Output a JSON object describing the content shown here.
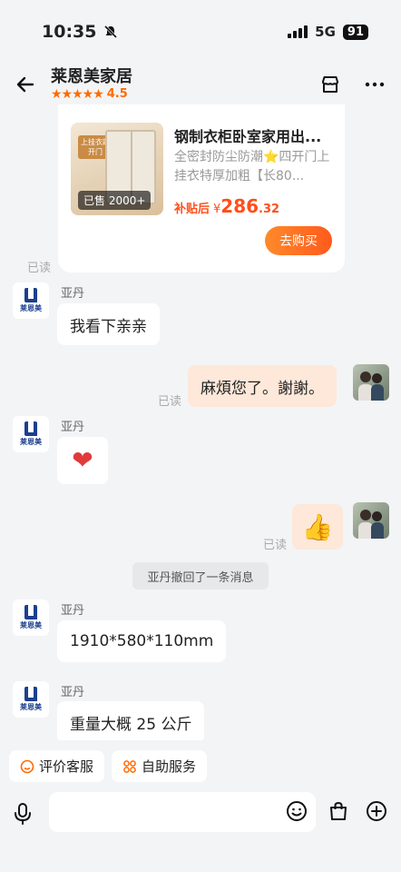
{
  "status_bar": {
    "time": "10:35",
    "network": "5G",
    "battery": "91"
  },
  "header": {
    "shop_name": "莱恩美家居",
    "rating": "4.5"
  },
  "product": {
    "img_tag": "上挂衣四开门",
    "sold": "已售 2000+",
    "title": "钢制衣柜卧室家用出...",
    "desc": "全密封防尘防潮⭐四开门上挂衣特厚加粗【长80...",
    "subsidy_label": "补贴后",
    "currency": "¥",
    "price_main": "286",
    "price_decimal": ".32",
    "buy_label": "去购买"
  },
  "shop_logo_text": "莱恩美",
  "messages": {
    "read_label": "已读",
    "sender_name": "亚丹",
    "m1": "我看下亲亲",
    "m2": "麻煩您了。謝謝。",
    "m3": "❤",
    "m4": "👍",
    "system": "亚丹撤回了一条消息",
    "m5": "1910*580*110mm",
    "m6": "重量大概 25 公斤"
  },
  "quick_actions": [
    {
      "label": "评价客服",
      "icon": "smile-icon"
    },
    {
      "label": "自助服务",
      "icon": "grid-icon"
    }
  ],
  "colors": {
    "accent": "#ff6a00",
    "price": "#ff4e1a",
    "my_bubble": "#fde8d9",
    "background": "#f3f4f6"
  }
}
